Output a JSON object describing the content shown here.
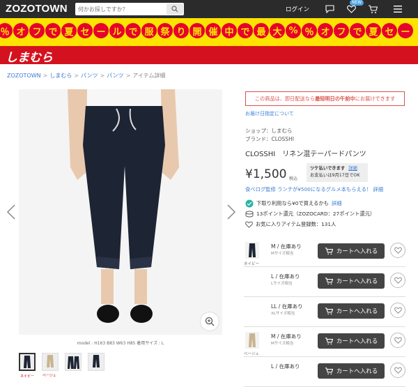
{
  "header": {
    "logo": "ZOZOTOWN",
    "search_placeholder": "何かお探しですか？",
    "login": "ログイン",
    "new_badge": "NEW"
  },
  "banner": {
    "chars": [
      "％",
      "オ",
      "フ",
      "で",
      "夏",
      "セ",
      "ー",
      "ル",
      "で",
      "服",
      "祭",
      "り",
      "開",
      "催",
      "中",
      "で",
      "最",
      "大",
      "%",
      "％",
      "オ",
      "フ",
      "で",
      "夏",
      "セ",
      "ー"
    ],
    "colors": {
      "bg": "#ffe300",
      "circle": "#e6002d"
    }
  },
  "brand_bar": {
    "name": "しまむら",
    "color": "#d4121f"
  },
  "breadcrumb": [
    {
      "label": "ZOZOTOWN",
      "link": true
    },
    {
      "label": "しまむら",
      "link": true
    },
    {
      "label": "パンツ",
      "link": true
    },
    {
      "label": "パンツ",
      "link": true
    },
    {
      "label": "アイテム詳細",
      "link": false
    }
  ],
  "image": {
    "model_info": "model : H163 B83 W63 H85  着用サイズ : L",
    "thumb_labels": [
      "ネイビー",
      "ベージュ",
      "",
      ""
    ]
  },
  "notice": {
    "prefix": "この商品は、即日配送なら",
    "highlight": "最短明日の午前中",
    "suffix": "にお届けできます"
  },
  "ship_link": "お届け日指定について",
  "product": {
    "shop": "ショップ：しまむら",
    "brand": "ブランド：CLOSSHI",
    "title": "CLOSSHI　リネン混テーパードパンツ",
    "price": "¥1,500",
    "tax": "税込",
    "tsuke_title": "ツケ払いできます",
    "tsuke_link": "詳細",
    "tsuke_sub": "お支払いは9月17日でOK",
    "promo": "食べログ監修 ランチが¥500になるグルメ本もらえる！ 詳細",
    "feature1": "下取り利用なら¥0で買えるかも",
    "feature1_link": "詳細",
    "feature2": "13ポイント還元（ZOZOCARD：27ポイント還元）",
    "feature3": "お気に入りアイテム登録数：131人"
  },
  "skus": [
    {
      "color_label": "ネイビー",
      "size": "M / 在庫あり",
      "sub": "Mサイズ相当",
      "cart": "カートへ入れる"
    },
    {
      "color_label": "",
      "size": "L / 在庫あり",
      "sub": "Lサイズ相当",
      "cart": "カートへ入れる"
    },
    {
      "color_label": "",
      "size": "LL / 在庫あり",
      "sub": "XLサイズ相当",
      "cart": "カートへ入れる"
    },
    {
      "color_label": "ベージュ",
      "size": "M / 在庫あり",
      "sub": "Mサイズ相当",
      "cart": "カートへ入れる"
    },
    {
      "color_label": "",
      "size": "L / 在庫あり",
      "sub": "",
      "cart": "カートへ入れる"
    }
  ]
}
